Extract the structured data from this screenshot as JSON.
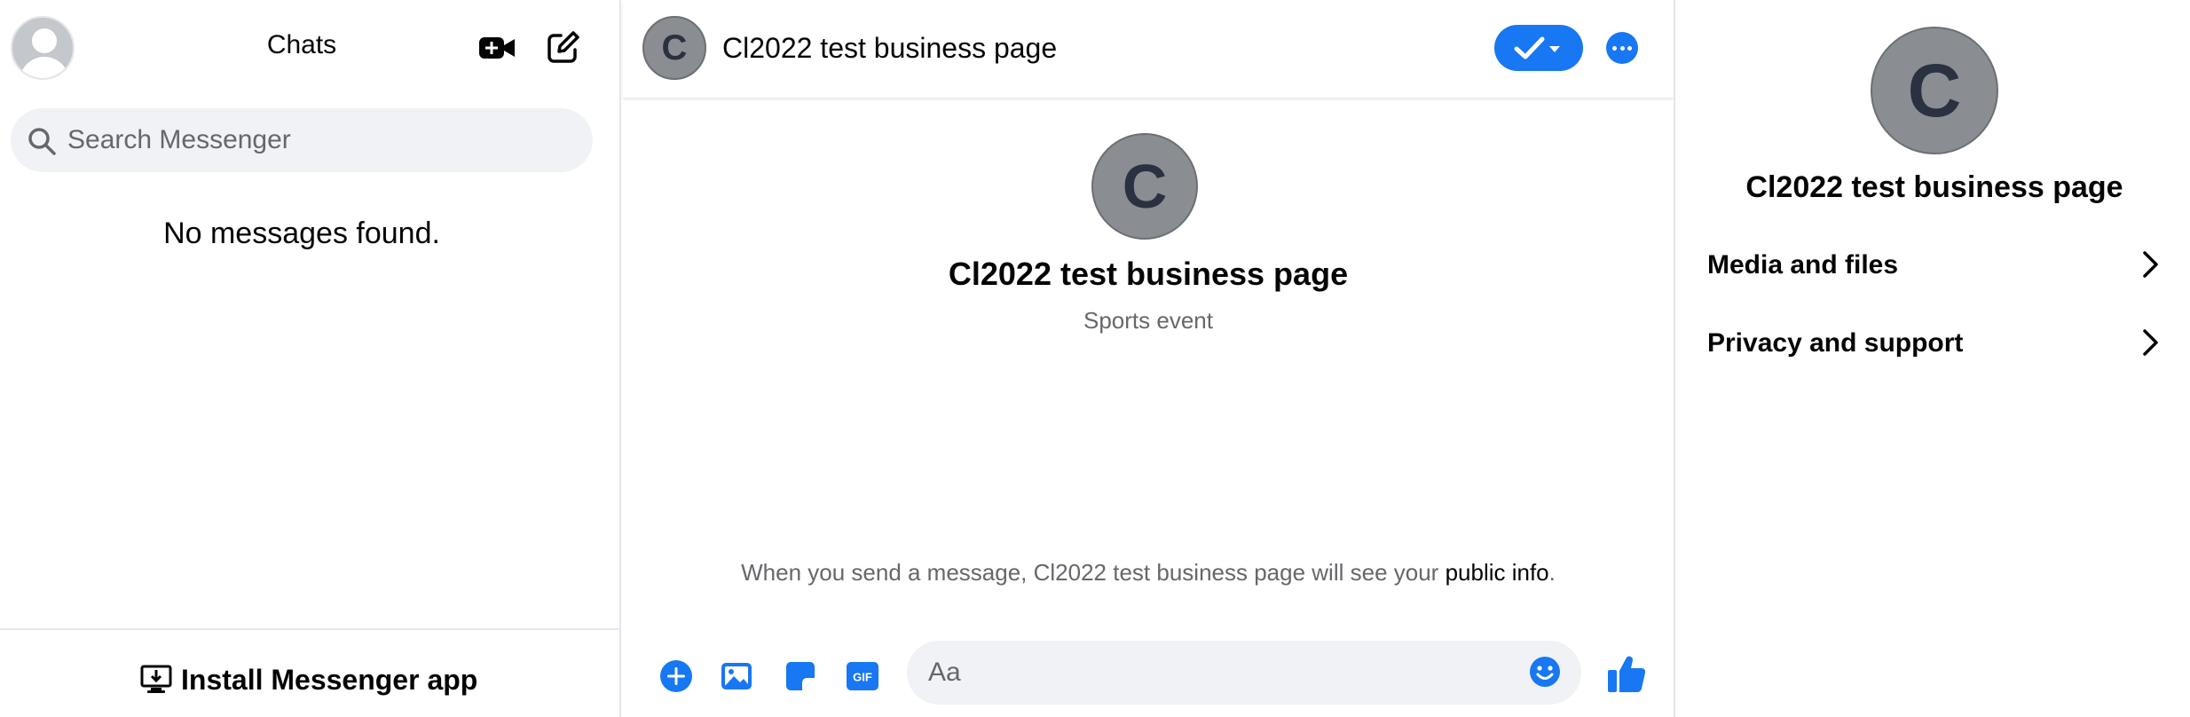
{
  "sidebar": {
    "title": "Chats",
    "search_placeholder": "Search Messenger",
    "empty_message": "No messages found.",
    "install_label": "Install Messenger app",
    "icons": {
      "avatar": "default-profile-icon",
      "new_room": "video-plus-icon",
      "compose": "compose-icon",
      "search": "search-icon",
      "install": "desktop-download-icon"
    }
  },
  "conversation": {
    "header": {
      "title": "Cl2022 test business page",
      "avatar_letter": "C"
    },
    "intro": {
      "avatar_letter": "C",
      "name": "Cl2022 test business page",
      "subtitle": "Sports event"
    },
    "notice": {
      "text": "When you send a message, Cl2022 test business page will see your ",
      "link": "public info",
      "suffix": "."
    },
    "composer": {
      "placeholder": "Aa",
      "icons": [
        "plus-icon",
        "image-icon",
        "sticker-icon",
        "gif-icon",
        "emoji-icon",
        "thumbs-up-icon"
      ]
    }
  },
  "info_panel": {
    "avatar_letter": "C",
    "name": "Cl2022 test business page",
    "rows": [
      {
        "label": "Media and files"
      },
      {
        "label": "Privacy and support"
      }
    ]
  },
  "colors": {
    "accent": "#1877f2",
    "avatar_gray": "#8a8d91",
    "avatar_letter": "#2a3141",
    "search_bg": "#f0f2f5",
    "secondary_text": "#65676b",
    "divider": "#e4e6eb"
  }
}
